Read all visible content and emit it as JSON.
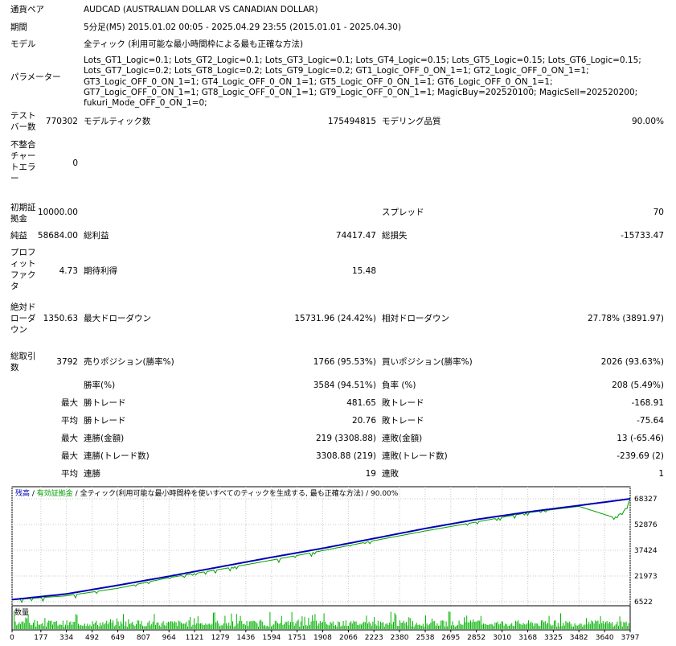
{
  "report": {
    "symbol_label": "通貨ペア",
    "symbol": "AUDCAD (AUSTRALIAN DOLLAR VS CANADIAN DOLLAR)",
    "period_label": "期間",
    "period": "5分足(M5) 2015.01.02 00:05 - 2025.04.29 23:55 (2015.01.01 - 2025.04.30)",
    "model_label": "モデル",
    "model": "全ティック (利用可能な最小時間枠による最も正確な方法)",
    "params_label": "パラメーター",
    "params": "Lots_GT1_Logic=0.1; Lots_GT2_Logic=0.1; Lots_GT3_Logic=0.1; Lots_GT4_Logic=0.15; Lots_GT5_Logic=0.15; Lots_GT6_Logic=0.15; Lots_GT7_Logic=0.2; Lots_GT8_Logic=0.2; Lots_GT9_Logic=0.2; GT1_Logic_OFF_0_ON_1=1; GT2_Logic_OFF_0_ON_1=1; GT3_Logic_OFF_0_ON_1=1; GT4_Logic_OFF_0_ON_1=1; GT5_Logic_OFF_0_ON_1=1; GT6_Logic_OFF_0_ON_1=1; GT7_Logic_OFF_0_ON_1=1; GT8_Logic_OFF_0_ON_1=1; GT9_Logic_OFF_0_ON_1=1; MagicBuy=202520100; MagicSell=202520200; fukuri_Mode_OFF_0_ON_1=0;",
    "bars_label": [
      "テスト",
      "バー数"
    ],
    "bars": "770302",
    "ticks_label": "モデルティック数",
    "ticks": "175494815",
    "quality_label": "モデリング品質",
    "quality": "90.00%",
    "mismatch_label": [
      "不整合",
      "チャー",
      "トエラ",
      "ー"
    ],
    "mismatch": "0",
    "deposit_label": [
      "初期証",
      "拠金"
    ],
    "deposit": "10000.00",
    "spread_label": "スプレッド",
    "spread": "70",
    "net_label": "純益",
    "net": "58684.00",
    "gross_profit_label": "総利益",
    "gross_profit": "74417.47",
    "gross_loss_label": "総損失",
    "gross_loss": "-15733.47",
    "pf_label": [
      "プロフ",
      "ィット",
      "ファク",
      "タ"
    ],
    "pf": "4.73",
    "expected_label": "期待利得",
    "expected": "15.48",
    "abs_dd_label": [
      "絶対ド",
      "ローダ",
      "ウン"
    ],
    "abs_dd": "1350.63",
    "max_dd_label": "最大ドローダウン",
    "max_dd": "15731.96 (24.42%)",
    "rel_dd_label": "相対ドローダウン",
    "rel_dd": "27.78% (3891.97)",
    "trades_label": [
      "総取引",
      "数"
    ],
    "trades": "3792",
    "short_label": "売りポジション(勝率%)",
    "short": "1766 (95.53%)",
    "long_label": "買いポジション(勝率%)",
    "long": "2026 (93.63%)",
    "win_pct_label": "勝率(%)",
    "win_pct": "3584 (94.51%)",
    "loss_pct_label": "負率 (%)",
    "loss_pct": "208 (5.49%)",
    "max_word": "最大",
    "avg_word": "平均",
    "largest_win_label": "勝トレード",
    "largest_win": "481.65",
    "largest_loss_label": "敗トレード",
    "largest_loss": "-168.91",
    "avg_win_label": "勝トレード",
    "avg_win": "20.76",
    "avg_loss_label": "敗トレード",
    "avg_loss": "-75.64",
    "max_consec_wins_label": "連勝(金額)",
    "max_consec_wins": "219 (3308.88)",
    "max_consec_losses_label": "連敗(金額)",
    "max_consec_losses": "13 (-65.46)",
    "max_consec_profit_label": "連勝(トレード数)",
    "max_consec_profit": "3308.88 (219)",
    "max_consec_loss_label": "連敗(トレード数)",
    "max_consec_loss": "-239.69 (2)",
    "avg_consec_wins_label": "連勝",
    "avg_consec_wins": "19",
    "avg_consec_losses_label": "連敗",
    "avg_consec_losses": "1"
  },
  "chart": {
    "legend_balance": "残高",
    "legend_sep1": " / ",
    "legend_equity": "有効証拠金",
    "legend_sep2": " / ",
    "legend_model": "全ティック(利用可能な最小時間枠を使いすべてのティックを生成する, 最も正確な方法)",
    "legend_sep3": " / ",
    "legend_quality": "90.00%",
    "volume_label": "数量",
    "colors": {
      "balance": "#0000b4",
      "equity": "#00a000",
      "volume": "#00b400",
      "grid": "#c8c8c8"
    }
  },
  "chart_data": {
    "type": "line",
    "series": [
      {
        "name": "残高",
        "x": [
          0,
          334,
          649,
          964,
          1279,
          1594,
          1908,
          2223,
          2538,
          2852,
          3168,
          3482,
          3797
        ],
        "y": [
          7800,
          11200,
          16400,
          21800,
          27500,
          33200,
          38600,
          44500,
          50500,
          55900,
          60400,
          64300,
          68327
        ]
      },
      {
        "name": "有効証拠金",
        "x": [
          0,
          334,
          649,
          964,
          1279,
          1594,
          1908,
          2223,
          2538,
          2852,
          3168,
          3482,
          3640,
          3700,
          3760,
          3797
        ],
        "y": [
          7700,
          10100,
          14600,
          21000,
          26000,
          31500,
          37200,
          43200,
          49000,
          54400,
          60000,
          63800,
          58900,
          57000,
          61000,
          68000
        ]
      }
    ],
    "x_ticks": [
      "0",
      "177",
      "334",
      "492",
      "649",
      "807",
      "964",
      "1121",
      "1279",
      "1436",
      "1594",
      "1751",
      "1908",
      "2066",
      "2223",
      "2380",
      "2538",
      "2695",
      "2852",
      "3010",
      "3168",
      "3325",
      "3482",
      "3640",
      "3797"
    ],
    "y_ticks": [
      "68327",
      "52876",
      "37424",
      "21973",
      "6522"
    ],
    "ylim": [
      6522,
      68327
    ],
    "xlim": [
      0,
      3797
    ]
  }
}
